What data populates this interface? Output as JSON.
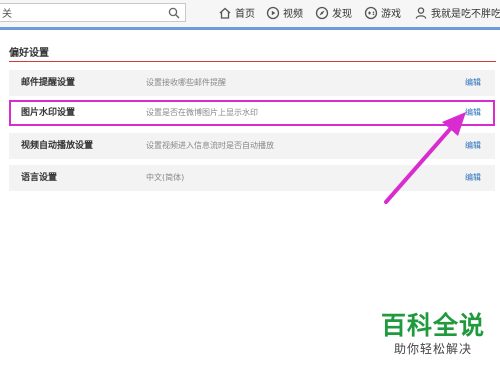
{
  "header": {
    "search": {
      "value": "关",
      "placeholder": ""
    },
    "nav": [
      {
        "label": "首页",
        "icon": "home-icon"
      },
      {
        "label": "视频",
        "icon": "video-icon"
      },
      {
        "label": "发现",
        "icon": "compass-icon"
      },
      {
        "label": "游戏",
        "icon": "gamepad-icon"
      },
      {
        "label": "我就是吃不胖吃…",
        "icon": "user-icon"
      }
    ]
  },
  "panel": {
    "title": "偏好设置",
    "rows": [
      {
        "label": "邮件提醒设置",
        "desc": "设置接收哪些邮件提醒",
        "edit": "编辑",
        "highlighted": false
      },
      {
        "label": "图片水印设置",
        "desc": "设置是否在微博图片上显示水印",
        "edit": "编辑",
        "highlighted": true
      },
      {
        "label": "视频自动播放设置",
        "desc": "设置视频进入信息流时是否自动播放",
        "edit": "编辑",
        "highlighted": false
      },
      {
        "label": "语言设置",
        "desc": "中文(简体)",
        "edit": "编辑",
        "highlighted": false
      }
    ]
  },
  "annotation": {
    "color": "#d92cd0"
  },
  "watermark": {
    "title": "百科全说",
    "subtitle": "助你轻松解决"
  },
  "colors": {
    "accent_line": "#6f9bd8",
    "rule": "#d43a3a",
    "link": "#2a6fbf",
    "brand_green": "#1f9a3c"
  }
}
